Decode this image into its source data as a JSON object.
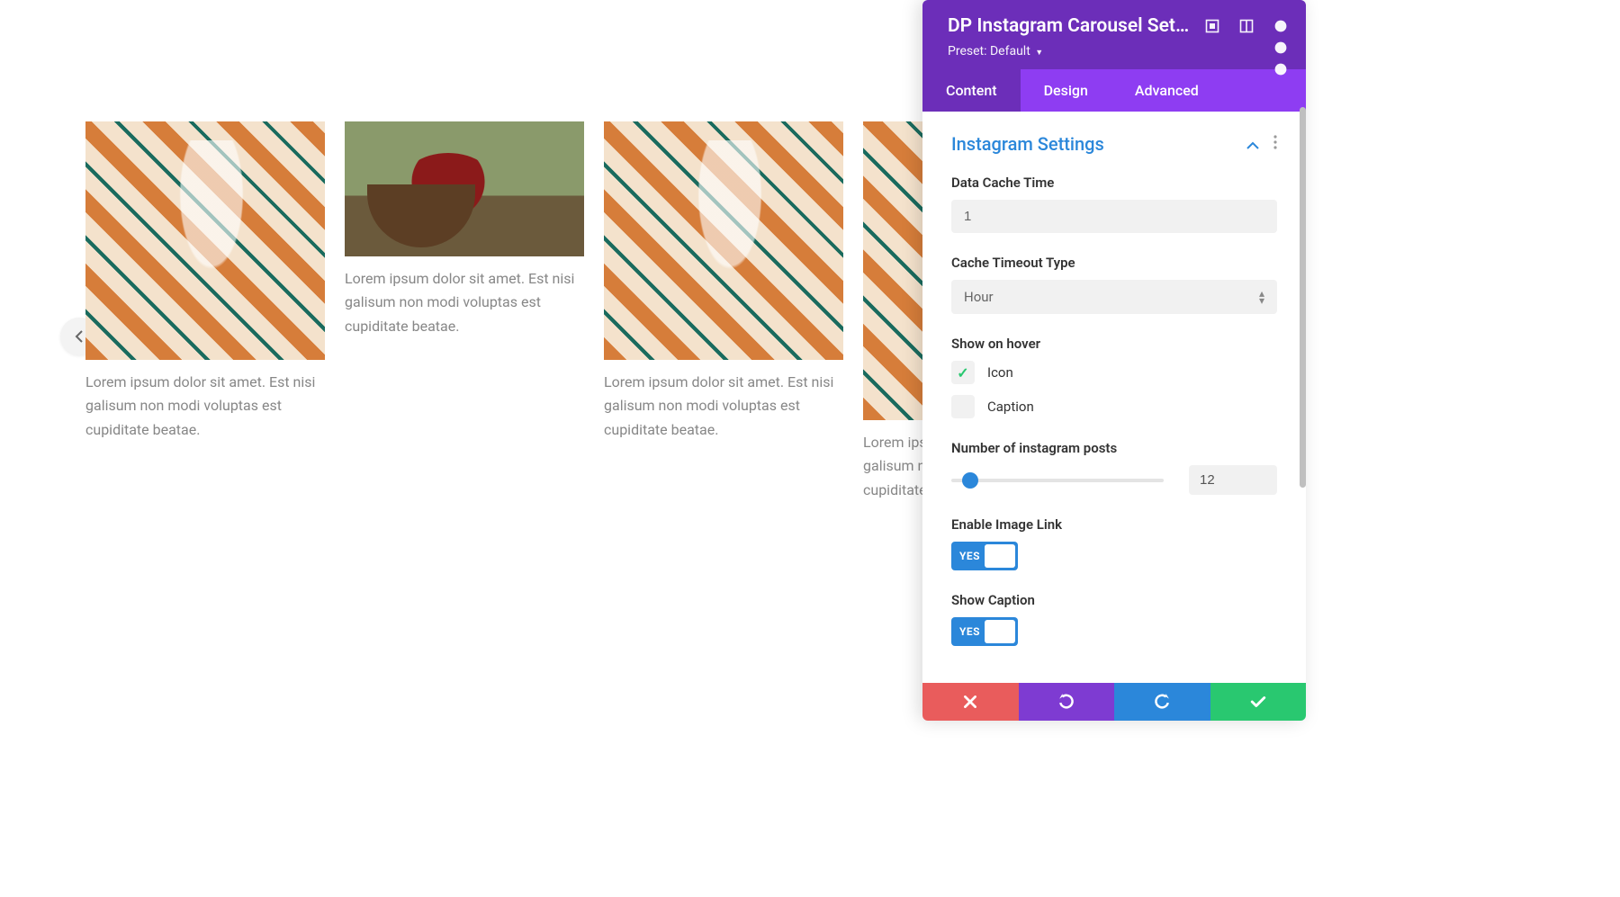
{
  "carousel": {
    "items": [
      {
        "caption": "Lorem ipsum dolor sit amet. Est nisi galisum non modi voluptas est cupiditate beatae."
      },
      {
        "caption": "Lorem ipsum dolor sit amet. Est nisi galisum non modi voluptas est cupiditate beatae."
      },
      {
        "caption": "Lorem ipsum dolor sit amet. Est nisi galisum non modi voluptas est cupiditate beatae."
      },
      {
        "caption": "Lorem ipsum dolor sit amet. Est nisi galisum non modi voluptas est cupiditate…"
      }
    ]
  },
  "panel": {
    "title": "DP Instagram Carousel Sett…",
    "preset_label": "Preset:",
    "preset_value": "Default",
    "tabs": {
      "content": "Content",
      "design": "Design",
      "advanced": "Advanced"
    },
    "section_title": "Instagram Settings",
    "fields": {
      "data_cache_time": {
        "label": "Data Cache Time",
        "value": "1"
      },
      "cache_timeout_type": {
        "label": "Cache Timeout Type",
        "value": "Hour"
      },
      "show_on_hover": {
        "label": "Show on hover",
        "icon": {
          "label": "Icon",
          "checked": true
        },
        "caption": {
          "label": "Caption",
          "checked": false
        }
      },
      "num_posts": {
        "label": "Number of instagram posts",
        "value": "12"
      },
      "enable_image_link": {
        "label": "Enable Image Link",
        "value": "YES"
      },
      "show_caption": {
        "label": "Show Caption",
        "value": "YES"
      }
    }
  },
  "colors": {
    "header": "#6c2eb9",
    "tabs_bg": "#8e3df2",
    "accent_blue": "#2b87da",
    "accent_green": "#29c870",
    "accent_red": "#e95c5c"
  }
}
